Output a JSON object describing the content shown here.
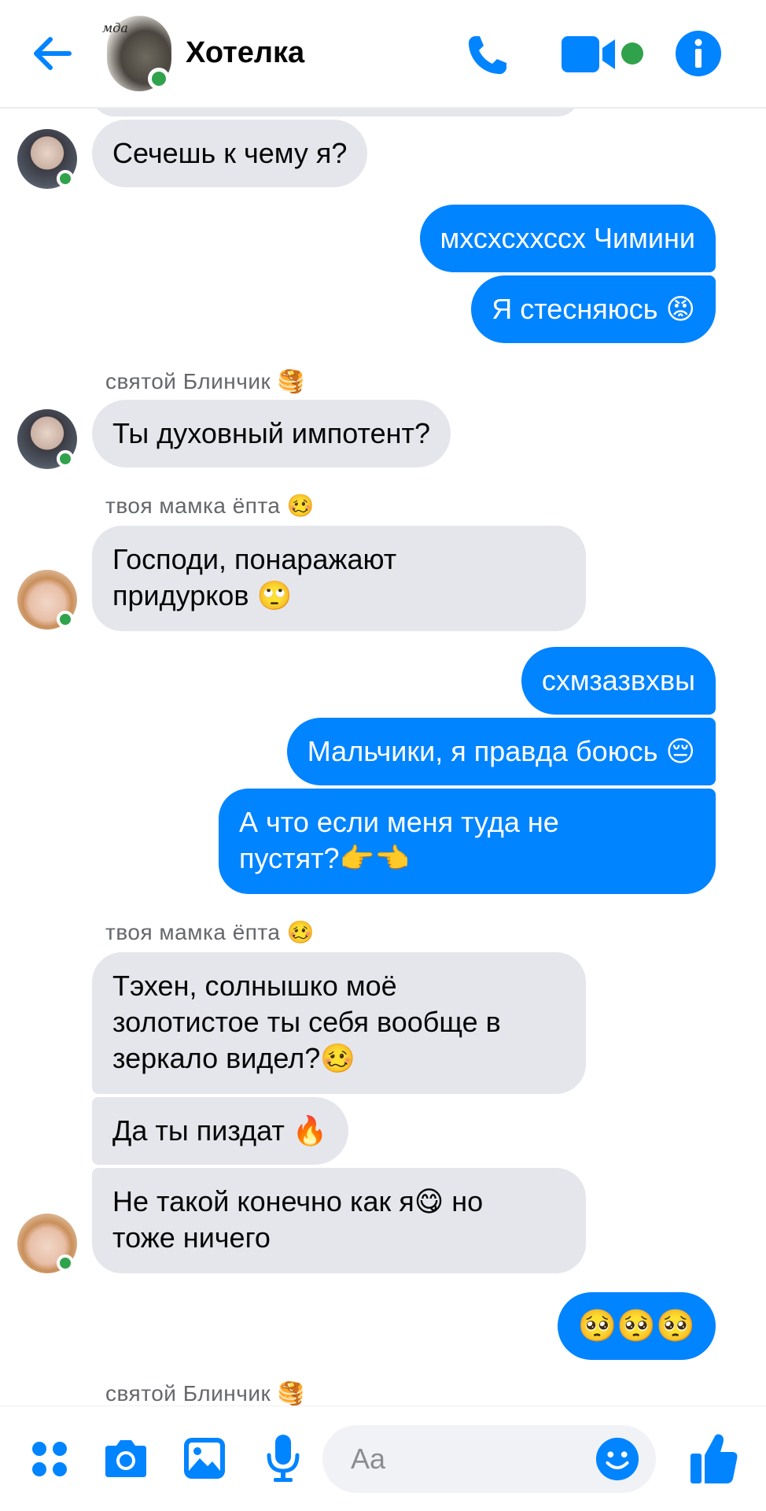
{
  "header": {
    "title": "Хотелка",
    "avatar_tag": "мда",
    "accent": "#0084ff",
    "online": "#31a24c"
  },
  "messages": [
    {
      "dir": "in",
      "text": "Сечешь к чему я?"
    },
    {
      "dir": "out",
      "text": "мхсхсххссх Чимини"
    },
    {
      "dir": "out",
      "text": "Я стесняюсь 😡"
    },
    {
      "sender": "святой Блинчик 🥞"
    },
    {
      "dir": "in",
      "text": "Ты духовный импотент?"
    },
    {
      "sender": "твоя мамка ёпта 🥴"
    },
    {
      "dir": "in",
      "lines": [
        "Господи, понаражают",
        "придурков 🙄"
      ]
    },
    {
      "dir": "out",
      "text": "схмзазвхвы"
    },
    {
      "dir": "out",
      "text": "Мальчики, я правда боюсь 😔"
    },
    {
      "dir": "out",
      "lines": [
        "А что если меня туда не",
        "пустят?👉👈"
      ]
    },
    {
      "sender": "твоя мамка ёпта 🥴"
    },
    {
      "dir": "in",
      "lines": [
        "Тэхен, солнышко моё",
        "золотистое ты себя вообще в",
        "зеркало видел?🥴"
      ]
    },
    {
      "dir": "in",
      "text": "Да ты пиздат 🔥"
    },
    {
      "dir": "in",
      "lines": [
        "Не такой конечно как я😋 но",
        "тоже ничего"
      ]
    },
    {
      "dir": "out",
      "text": "🥺🥺🥺"
    },
    {
      "sender": "святой Блинчик 🥞"
    }
  ],
  "composer": {
    "placeholder": "Aa",
    "icons": [
      "menu-dots-icon",
      "camera-icon",
      "gallery-icon",
      "microphone-icon",
      "emoji-icon",
      "thumbs-up-icon"
    ]
  }
}
